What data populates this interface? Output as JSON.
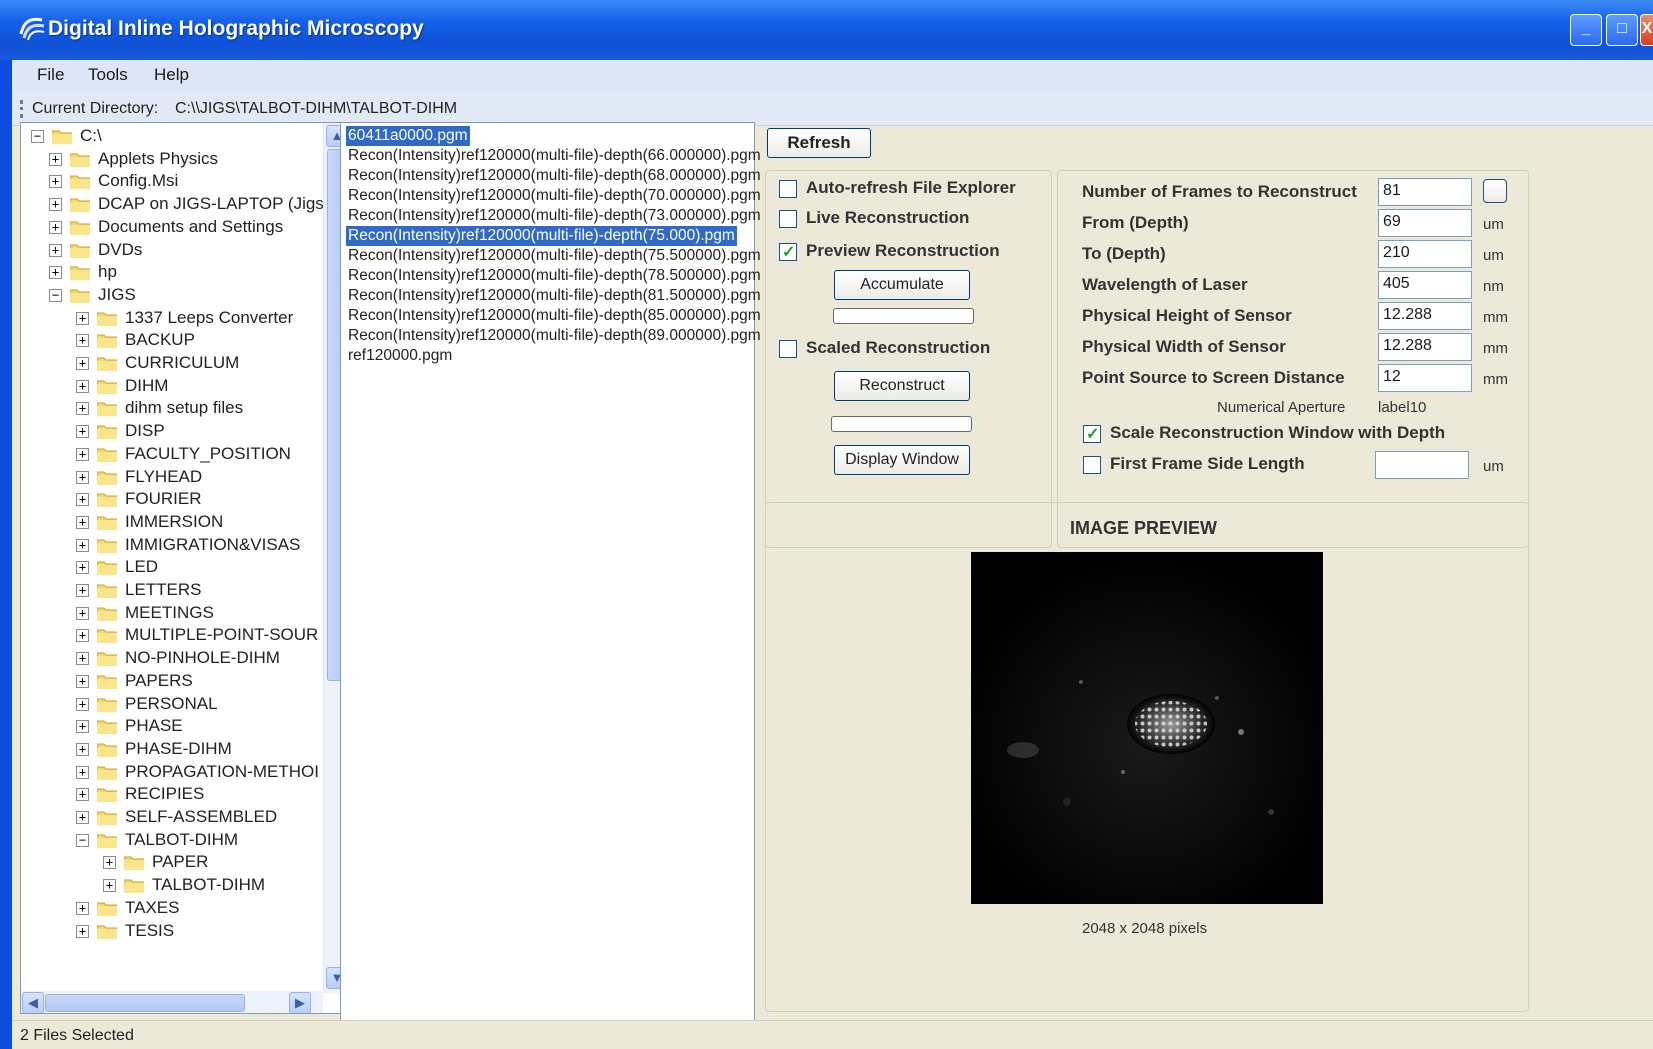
{
  "window": {
    "title": "Digital Inline Holographic Microscopy",
    "minimize_glyph": "_",
    "maximize_glyph": "□",
    "close_glyph": "X"
  },
  "menu": {
    "file": "File",
    "tools": "Tools",
    "help": "Help"
  },
  "toolbar": {
    "dir_label": "Current Directory:",
    "dir_value": "C:\\\\JIGS\\TALBOT-DIHM\\TALBOT-DIHM"
  },
  "tree": {
    "root": "C:\\",
    "items": [
      {
        "label": "Applets Physics",
        "level": 1,
        "expander": "+"
      },
      {
        "label": "Config.Msi",
        "level": 1,
        "expander": "+"
      },
      {
        "label": "DCAP on JIGS-LAPTOP (Jigs-",
        "level": 1,
        "expander": "+"
      },
      {
        "label": "Documents and Settings",
        "level": 1,
        "expander": "+"
      },
      {
        "label": "DVDs",
        "level": 1,
        "expander": "+"
      },
      {
        "label": "hp",
        "level": 1,
        "expander": "+"
      },
      {
        "label": "JIGS",
        "level": 1,
        "expander": "−"
      },
      {
        "label": "1337 Leeps Converter",
        "level": 2,
        "expander": "+"
      },
      {
        "label": "BACKUP",
        "level": 2,
        "expander": "+"
      },
      {
        "label": "CURRICULUM",
        "level": 2,
        "expander": "+"
      },
      {
        "label": "DIHM",
        "level": 2,
        "expander": "+"
      },
      {
        "label": "dihm setup files",
        "level": 2,
        "expander": "+"
      },
      {
        "label": "DISP",
        "level": 2,
        "expander": "+"
      },
      {
        "label": "FACULTY_POSITION",
        "level": 2,
        "expander": "+"
      },
      {
        "label": "FLYHEAD",
        "level": 2,
        "expander": "+"
      },
      {
        "label": "FOURIER",
        "level": 2,
        "expander": "+"
      },
      {
        "label": "IMMERSION",
        "level": 2,
        "expander": "+"
      },
      {
        "label": "IMMIGRATION&VISAS",
        "level": 2,
        "expander": "+"
      },
      {
        "label": "LED",
        "level": 2,
        "expander": "+"
      },
      {
        "label": "LETTERS",
        "level": 2,
        "expander": "+"
      },
      {
        "label": "MEETINGS",
        "level": 2,
        "expander": "+"
      },
      {
        "label": "MULTIPLE-POINT-SOUR",
        "level": 2,
        "expander": "+"
      },
      {
        "label": "NO-PINHOLE-DIHM",
        "level": 2,
        "expander": "+"
      },
      {
        "label": "PAPERS",
        "level": 2,
        "expander": "+"
      },
      {
        "label": "PERSONAL",
        "level": 2,
        "expander": "+"
      },
      {
        "label": "PHASE",
        "level": 2,
        "expander": "+"
      },
      {
        "label": "PHASE-DIHM",
        "level": 2,
        "expander": "+"
      },
      {
        "label": "PROPAGATION-METHOI",
        "level": 2,
        "expander": "+"
      },
      {
        "label": "RECIPIES",
        "level": 2,
        "expander": "+"
      },
      {
        "label": "SELF-ASSEMBLED",
        "level": 2,
        "expander": "+"
      },
      {
        "label": "TALBOT-DIHM",
        "level": 2,
        "expander": "−"
      },
      {
        "label": "PAPER",
        "level": 3,
        "expander": "+"
      },
      {
        "label": "TALBOT-DIHM",
        "level": 3,
        "expander": "+"
      },
      {
        "label": "TAXES",
        "level": 2,
        "expander": "+"
      },
      {
        "label": "TESIS",
        "level": 2,
        "expander": "+"
      }
    ],
    "scroll_up_glyph": "▲",
    "scroll_down_glyph": "▼",
    "scroll_left_glyph": "◀",
    "scroll_right_glyph": "▶"
  },
  "files": [
    {
      "name": "60411a0000.pgm",
      "selected": true
    },
    {
      "name": "Recon(Intensity)ref120000(multi-file)-depth(66.000000).pgm",
      "selected": false
    },
    {
      "name": "Recon(Intensity)ref120000(multi-file)-depth(68.000000).pgm",
      "selected": false
    },
    {
      "name": "Recon(Intensity)ref120000(multi-file)-depth(70.000000).pgm",
      "selected": false
    },
    {
      "name": "Recon(Intensity)ref120000(multi-file)-depth(73.000000).pgm",
      "selected": false
    },
    {
      "name": "Recon(Intensity)ref120000(multi-file)-depth(75.000).pgm",
      "selected": true
    },
    {
      "name": "Recon(Intensity)ref120000(multi-file)-depth(75.500000).pgm",
      "selected": false
    },
    {
      "name": "Recon(Intensity)ref120000(multi-file)-depth(78.500000).pgm",
      "selected": false
    },
    {
      "name": "Recon(Intensity)ref120000(multi-file)-depth(81.500000).pgm",
      "selected": false
    },
    {
      "name": "Recon(Intensity)ref120000(multi-file)-depth(85.000000).pgm",
      "selected": false
    },
    {
      "name": "Recon(Intensity)ref120000(multi-file)-depth(89.000000).pgm",
      "selected": false
    },
    {
      "name": "ref120000.pgm",
      "selected": false
    }
  ],
  "controls": {
    "refresh": "Refresh",
    "auto_refresh": {
      "label": "Auto-refresh File Explorer",
      "checked": false
    },
    "live_reconstruction": {
      "label": "Live Reconstruction",
      "checked": false
    },
    "preview_reconstruction": {
      "label": "Preview Reconstruction",
      "checked": true
    },
    "accumulate": "Accumulate",
    "scaled_reconstruction": {
      "label": "Scaled Reconstruction",
      "checked": false
    },
    "reconstruct": "Reconstruct",
    "display_window": "Display Window",
    "check_glyph": "✓"
  },
  "params": {
    "frames": {
      "label": "Number of Frames to Reconstruct",
      "value": "81"
    },
    "from_depth": {
      "label": "From (Depth)",
      "value": "69",
      "unit": "um"
    },
    "to_depth": {
      "label": "To (Depth)",
      "value": "210",
      "unit": "um"
    },
    "wavelength": {
      "label": "Wavelength of Laser",
      "value": "405",
      "unit": "nm"
    },
    "height": {
      "label": "Physical Height of Sensor",
      "value": "12.288",
      "unit": "mm"
    },
    "width": {
      "label": "Physical Width of Sensor",
      "value": "12.288",
      "unit": "mm"
    },
    "distance": {
      "label": "Point Source to Screen Distance",
      "value": "12",
      "unit": "mm"
    },
    "na": {
      "label": "Numerical Aperture",
      "value": "label10"
    },
    "scale_window": {
      "label": "Scale Reconstruction Window with Depth",
      "checked": true
    },
    "first_frame": {
      "label": "First Frame Side Length",
      "checked": false,
      "value": "",
      "unit": "um"
    }
  },
  "preview": {
    "title": "IMAGE PREVIEW",
    "size": "2048 x 2048 pixels"
  },
  "status": {
    "text": "2 Files Selected"
  },
  "colors": {
    "selection": "#316ac5",
    "titlebar": "#0f52d8",
    "check": "#21a121"
  }
}
